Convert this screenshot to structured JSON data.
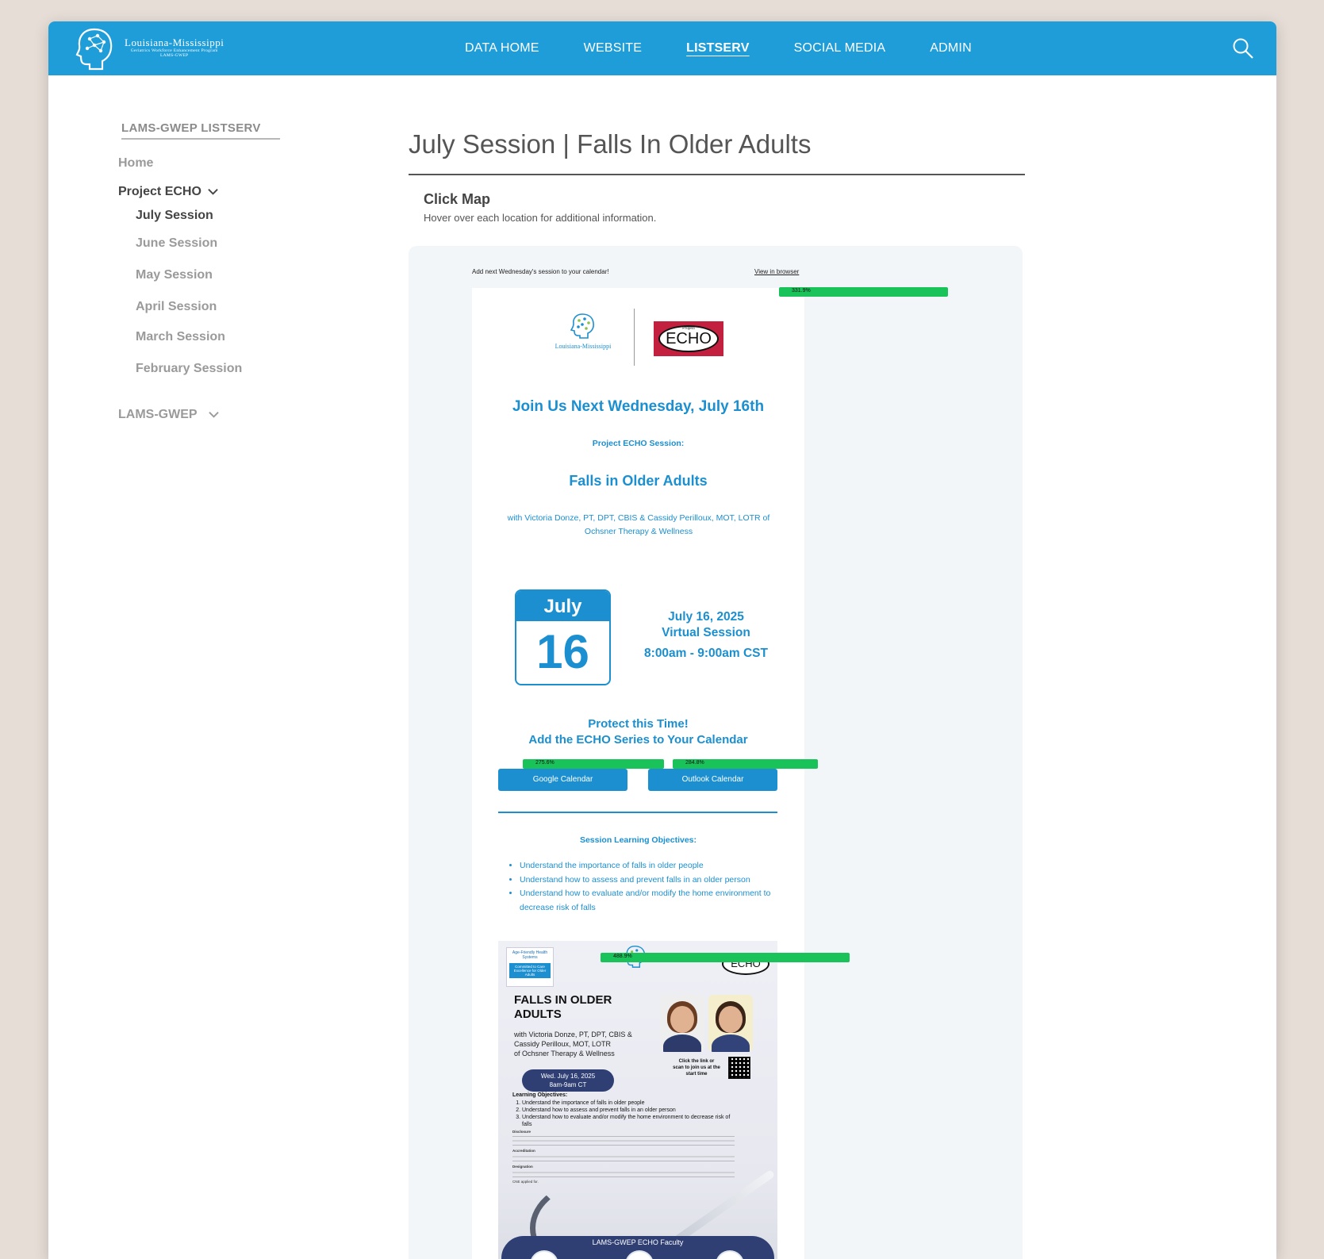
{
  "header": {
    "logo_title": "Louisiana-Mississippi",
    "logo_sub1": "Geriatrics Workforce Enhancement Program",
    "logo_sub2": "LAMS-GWEP",
    "nav": [
      "DATA HOME",
      "WEBSITE",
      "LISTSERV",
      "SOCIAL MEDIA",
      "ADMIN"
    ],
    "active_nav": "LISTSERV",
    "accent_color": "#1e9dd9"
  },
  "sidebar": {
    "heading": "LAMS-GWEP LISTSERV",
    "home": "Home",
    "project_echo": "Project ECHO",
    "sessions": [
      "July Session",
      "June Session",
      "May Session",
      "April Session",
      "March Session",
      "February Session"
    ],
    "lams_gwep": "LAMS-GWEP"
  },
  "main": {
    "title": "July Session | Falls In Older Adults",
    "click_map_title": "Click Map",
    "click_map_sub": "Hover over each location for additional information."
  },
  "email": {
    "top_left": "Add next Wednesday's session to your calendar!",
    "top_right": "View in browser",
    "echo_proj": "Project",
    "echo_text": "ECHO",
    "join": "Join Us Next Wednesday, July 16th",
    "project_session": "Project ECHO Session:",
    "falls": "Falls in Older Adults",
    "with": "with Victoria Donze, PT, DPT, CBIS & Cassidy Perilloux, MOT, LOTR of Ochsner Therapy & Wellness",
    "cal_month": "July",
    "cal_day": "16",
    "session_date": "July 16, 2025",
    "session_type": "Virtual Session",
    "session_time": "8:00am - 9:00am CST",
    "protect1": "Protect this Time!",
    "protect2": "Add the ECHO Series to Your Calendar",
    "google_btn": "Google Calendar",
    "outlook_btn": "Outlook Calendar",
    "objectives_heading": "Session Learning Objectives:",
    "objectives": [
      "Understand the importance of falls in older people",
      "Understand how to assess and prevent falls in an older person",
      "Understand how to evaluate and/or modify the home environment to decrease risk of falls"
    ]
  },
  "flyer": {
    "badge1": "Age-Friendly Health Systems",
    "badge2": "Committed to Care Excellence for Older Adults",
    "title": "FALLS IN OLDER ADULTS",
    "with1": "with Victoria Donze, PT, DPT, CBIS &",
    "with2": "Cassidy Perilloux, MOT, LOTR",
    "with3": "of Ochsner Therapy & Wellness",
    "date1": "Wed. July 16, 2025",
    "date2": "8am-9am CT",
    "click_note": "Click the link or scan to join us at the start time",
    "lo_heading": "Learning Objectives:",
    "lo": [
      "Understand the importance of falls in older people",
      "Understand how to assess and prevent falls in an older person",
      "Understand how to evaluate and/or modify the home environment to decrease risk of falls"
    ],
    "fine_disclosure": "Disclosure",
    "fine_accreditation": "Accreditation",
    "fine_designation": "Designation",
    "fine_cne": "CNE applied for.",
    "faculty_label": "LAMS-GWEP ECHO Faculty"
  },
  "overlays": {
    "view_in_browser": "331.9%",
    "google": "275.6%",
    "outlook": "284.8%",
    "flyer": "488.9%",
    "color": "#19c35a"
  }
}
